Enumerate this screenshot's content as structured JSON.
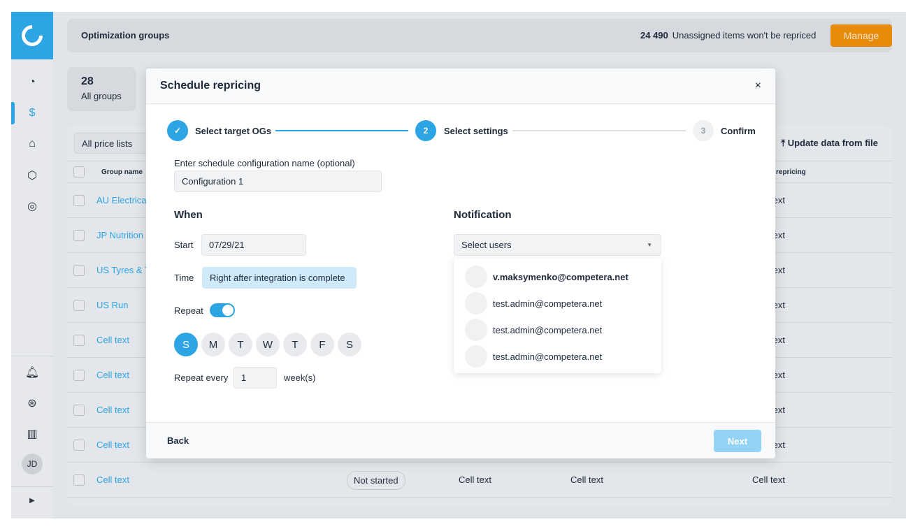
{
  "colors": {
    "accent": "#2da4e3",
    "manage": "#e88b0b"
  },
  "sidebar": {
    "icons": [
      "pie-chart-icon",
      "dollar-cycle-icon",
      "tag-icon",
      "box-icon",
      "target-icon",
      "bell-icon",
      "lifebuoy-icon",
      "briefcase-icon"
    ],
    "avatar": "JD"
  },
  "header": {
    "title": "Optimization groups",
    "unassigned_count": "24 490",
    "unassigned_text": "Unassigned items won't be repriced",
    "manage": "Manage"
  },
  "summary": {
    "count": "28",
    "label": "All groups"
  },
  "table": {
    "filter": "All price lists",
    "upload": "Update data from file",
    "col_group": "Group name",
    "col_last": "repricing",
    "rows": [
      {
        "name": "AU Electrica",
        "last": "Cell text"
      },
      {
        "name": "JP Nutrition",
        "last": "Cell text"
      },
      {
        "name": "US Tyres & T",
        "last": "Cell text"
      },
      {
        "name": "US Run",
        "last": "Cell text"
      },
      {
        "name": "Cell text",
        "last": "Cell text"
      },
      {
        "name": "Cell text",
        "last": "Cell text"
      },
      {
        "name": "Cell text",
        "last": "Cell text"
      },
      {
        "name": "Cell text",
        "last": "Cell text"
      }
    ],
    "last_row": {
      "name": "Cell text",
      "status": "Not started",
      "c1": "Cell text",
      "c2": "Cell text",
      "c3": "Cell text"
    }
  },
  "modal": {
    "title": "Schedule repricing",
    "close": "×",
    "steps": [
      {
        "num": "✓",
        "label": "Select target OGs",
        "state": "done"
      },
      {
        "num": "2",
        "label": "Select settings",
        "state": "active"
      },
      {
        "num": "3",
        "label": "Confirm",
        "state": "todo"
      }
    ],
    "config_label": "Enter schedule configuration name (optional)",
    "config_value": "Configuration 1",
    "when": "When",
    "start_label": "Start",
    "start_value": "07/29/21",
    "time_label": "Time",
    "time_value": "Right after integration is complete",
    "repeat_label": "Repeat",
    "repeat_on": true,
    "days": [
      {
        "d": "S",
        "on": true
      },
      {
        "d": "M",
        "on": false
      },
      {
        "d": "T",
        "on": false
      },
      {
        "d": "W",
        "on": false
      },
      {
        "d": "T",
        "on": false
      },
      {
        "d": "F",
        "on": false
      },
      {
        "d": "S",
        "on": false
      }
    ],
    "repeat_every_label": "Repeat every",
    "repeat_every_value": "1",
    "repeat_unit": "week(s)",
    "notification": "Notification",
    "select_placeholder": "Select users",
    "users": [
      "v.maksymenko@competera.net",
      "test.admin@competera.net",
      "test.admin@competera.net",
      "test.admin@competera.net"
    ],
    "back": "Back",
    "next": "Next"
  }
}
